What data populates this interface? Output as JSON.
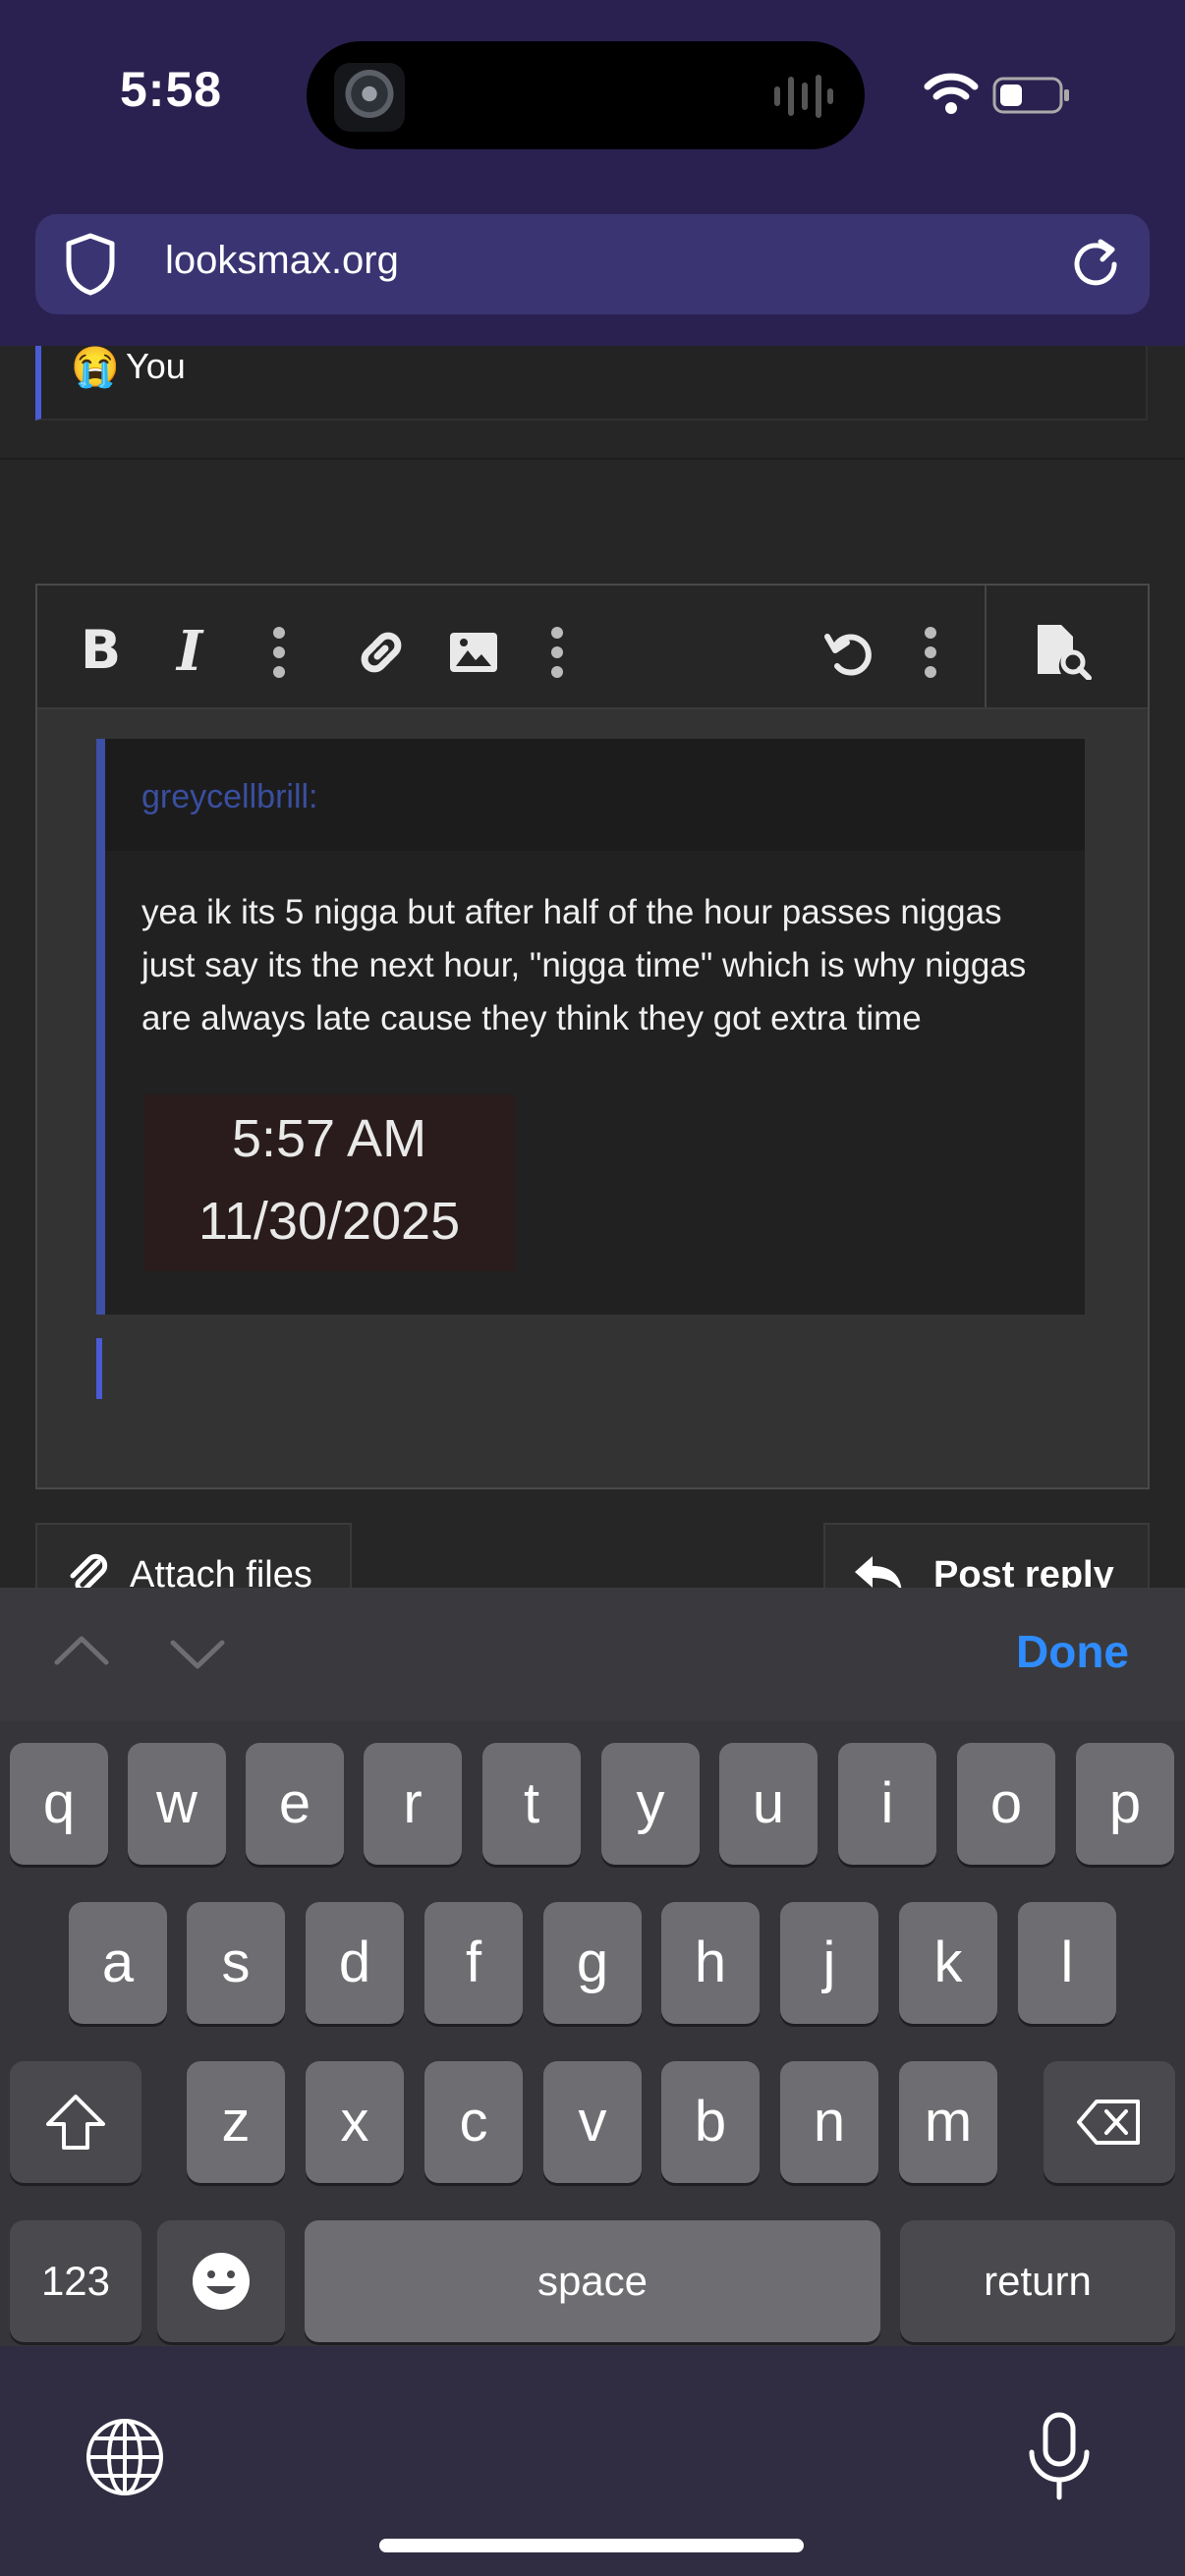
{
  "status_bar": {
    "time": "5:58"
  },
  "browser": {
    "url": "looksmax.org"
  },
  "reply_context": {
    "emoji": "😭",
    "author": "You"
  },
  "editor": {
    "quote": {
      "header": "greycellbrill:",
      "body": "yea ik its 5 nigga but after half of the hour passes niggas just say its the next hour, \"nigga time\" which is why niggas are always late cause they think they got extra time",
      "image_time": "5:57 AM",
      "image_date": "11/30/2025"
    },
    "toolbar_icons": [
      "bold-icon",
      "italic-icon",
      "more-icon",
      "link-icon",
      "image-icon",
      "more-icon",
      "undo-icon",
      "more-icon",
      "preview-icon"
    ],
    "bold_label": "B",
    "italic_label": "I"
  },
  "actions": {
    "attach_label": "Attach files",
    "post_label": "Post reply"
  },
  "keyboard": {
    "done_label": "Done",
    "row1": [
      "q",
      "w",
      "e",
      "r",
      "t",
      "y",
      "u",
      "i",
      "o",
      "p"
    ],
    "row2": [
      "a",
      "s",
      "d",
      "f",
      "g",
      "h",
      "j",
      "k",
      "l"
    ],
    "row3": [
      "z",
      "x",
      "c",
      "v",
      "b",
      "n",
      "m"
    ],
    "numbers_label": "123",
    "space_label": "space",
    "return_label": "return"
  },
  "colors": {
    "accent": "#2f8cff",
    "header_bg": "#2a2150",
    "quote_border": "#3e4fa8"
  }
}
